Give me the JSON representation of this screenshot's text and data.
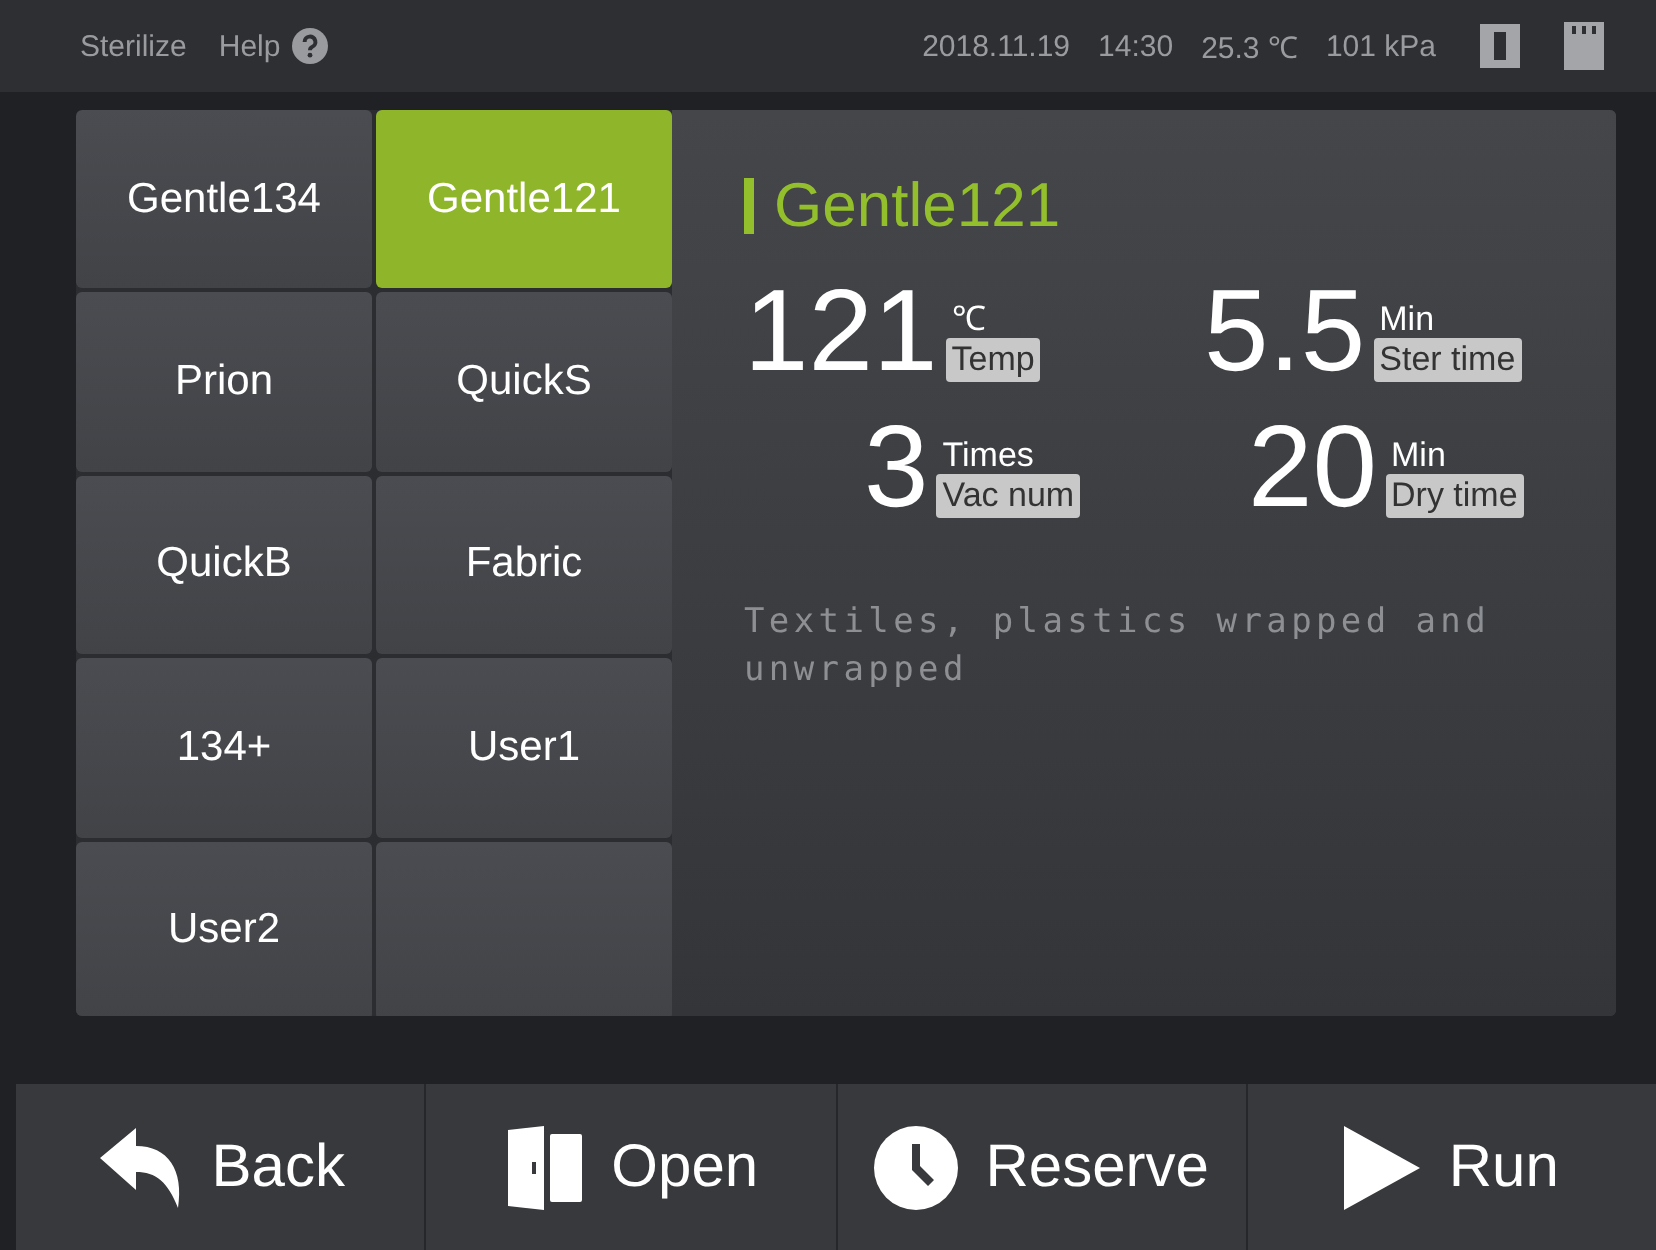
{
  "top_bar": {
    "menu": [
      "Sterilize",
      "Help"
    ],
    "date": "2018.11.19",
    "time": "14:30",
    "temperature": "25.3 ℃",
    "pressure": "101 kPa"
  },
  "programs": [
    {
      "label": "Gentle134",
      "selected": false
    },
    {
      "label": "Gentle121",
      "selected": true
    },
    {
      "label": "Prion",
      "selected": false
    },
    {
      "label": "QuickS",
      "selected": false
    },
    {
      "label": "QuickB",
      "selected": false
    },
    {
      "label": "Fabric",
      "selected": false
    },
    {
      "label": "134+",
      "selected": false
    },
    {
      "label": "User1",
      "selected": false
    },
    {
      "label": "User2",
      "selected": false
    }
  ],
  "detail": {
    "title": "Gentle121",
    "params": [
      {
        "value": "121",
        "unit": "℃",
        "label": "Temp"
      },
      {
        "value": "5.5",
        "unit": "Min",
        "label": "Ster time"
      },
      {
        "value": "3",
        "unit": "Times",
        "label": "Vac num"
      },
      {
        "value": "20",
        "unit": "Min",
        "label": "Dry time"
      }
    ],
    "description": "Textiles, plastics wrapped and unwrapped"
  },
  "actions": [
    {
      "kind": "back",
      "label": "Back"
    },
    {
      "kind": "open",
      "label": "Open"
    },
    {
      "kind": "reserve",
      "label": "Reserve"
    },
    {
      "kind": "run",
      "label": "Run"
    }
  ]
}
